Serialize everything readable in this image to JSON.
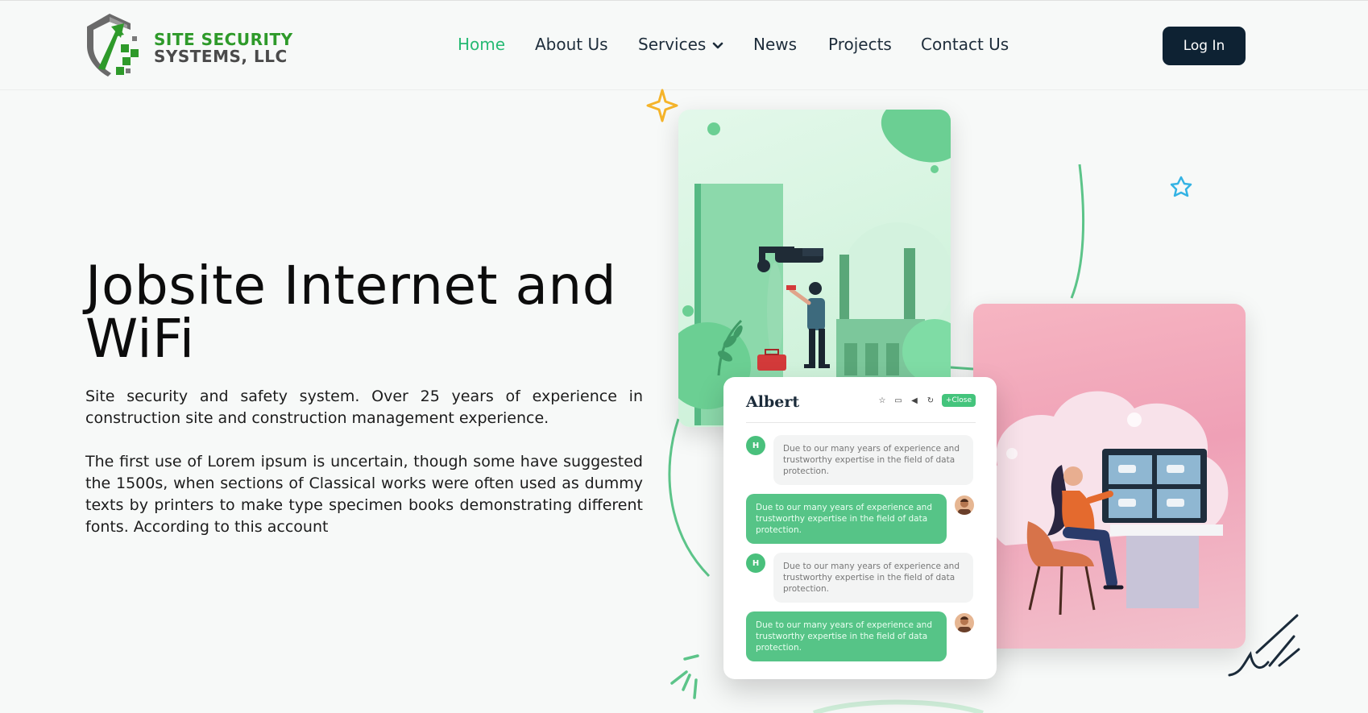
{
  "brand": {
    "line1": "SITE SECURITY",
    "line2": "SYSTEMS, LLC",
    "green": "#2e9a2a",
    "gray": "#4a4a4a"
  },
  "nav": {
    "items": [
      {
        "label": "Home",
        "active": true
      },
      {
        "label": "About Us"
      },
      {
        "label": "Services",
        "has_dropdown": true
      },
      {
        "label": "News"
      },
      {
        "label": "Projects"
      },
      {
        "label": "Contact Us"
      }
    ],
    "login_label": "Log In",
    "active_color": "#27ba74",
    "text_color": "#1e2d3b",
    "login_bg": "#0e2233"
  },
  "hero": {
    "title": "Jobsite Internet and WiFi",
    "paragraph1": "Site security and safety system. Over 25 years of experience in construction site and construction management experience.",
    "paragraph2": "The first use of Lorem ipsum is uncertain, though some have suggested the 1500s, when sections of Classical works were often used as dummy texts by printers to make type specimen books demonstrating different fonts. According to this account"
  },
  "chat": {
    "name": "Albert",
    "close_label": "+Close",
    "agent_initial": "H",
    "messages": [
      {
        "from": "agent",
        "text": "Due to our many years of experience and trustworthy expertise in the field of data protection."
      },
      {
        "from": "user",
        "text": "Due to our many years of experience and trustworthy expertise in the field of data protection."
      },
      {
        "from": "agent",
        "text": "Due to our many years of experience and trustworthy expertise in the field of data protection."
      },
      {
        "from": "user",
        "text": "Due to our many years of experience and trustworthy expertise in the field of data protection."
      }
    ]
  },
  "icons": [
    "shield-logo-icon",
    "chevron-down-icon",
    "sparkle-icon",
    "star-outline-icon",
    "camera-icon",
    "monitor-icon"
  ]
}
